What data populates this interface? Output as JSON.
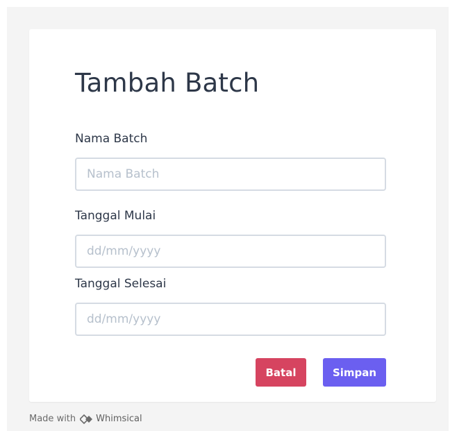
{
  "form": {
    "title": "Tambah Batch",
    "fields": [
      {
        "label": "Nama Batch",
        "placeholder": "Nama Batch",
        "value": ""
      },
      {
        "label": "Tanggal Mulai",
        "placeholder": "dd/mm/yyyy",
        "value": ""
      },
      {
        "label": "Tanggal Selesai",
        "placeholder": "dd/mm/yyyy",
        "value": ""
      }
    ],
    "actions": {
      "cancel_label": "Batal",
      "save_label": "Simpan"
    }
  },
  "footer": {
    "made_with": "Made with",
    "brand": "Whimsical",
    "icon": "whimsical-logo-icon"
  },
  "colors": {
    "cancel": "#d64460",
    "save": "#6b5ff0",
    "input_border": "#d5dbe3",
    "placeholder": "#b6c0cc"
  }
}
